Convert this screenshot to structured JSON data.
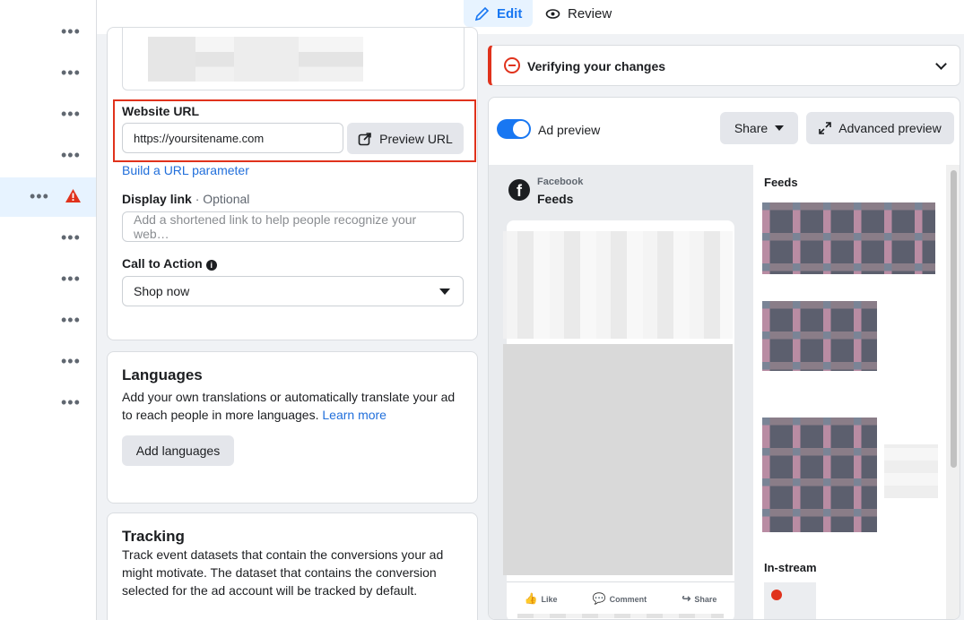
{
  "topbar": {
    "tabs": [
      {
        "label": "Edit",
        "icon": "pencil-icon",
        "active": true
      },
      {
        "label": "Review",
        "icon": "eye-icon",
        "active": false
      }
    ]
  },
  "rail": {
    "more_glyph": "•••",
    "warning_icon": "warning-triangle-icon",
    "warning_color": "#e0321c"
  },
  "destination": {
    "website_url_label": "Website URL",
    "website_url_value": "https://yoursitename.com",
    "preview_url_label": "Preview URL",
    "build_url_param": "Build a URL parameter",
    "display_link_label": "Display link",
    "display_link_optional": " · Optional",
    "display_link_placeholder": "Add a shortened link to help people recognize your web…",
    "cta_label": "Call to Action",
    "cta_info": "i",
    "cta_value": "Shop now"
  },
  "languages": {
    "title": "Languages",
    "description": "Add your own translations or automatically translate your ad to reach people in more languages.",
    "learn_more": "Learn more",
    "add_button": "Add languages"
  },
  "tracking": {
    "title": "Tracking",
    "description": "Track event datasets that contain the conversions your ad might motivate. The dataset that contains the conversion selected for the ad account will be tracked by default."
  },
  "verify": {
    "title": "Verifying your changes",
    "status_color": "#e0321c"
  },
  "preview": {
    "toggle_label": "Ad preview",
    "toggle_on": true,
    "share_label": "Share",
    "advanced_label": "Advanced preview",
    "platform_small": "Facebook",
    "platform_big": "Feeds",
    "fb_logo": "f",
    "actions": [
      {
        "icon": "👍",
        "label": "Like"
      },
      {
        "icon": "💬",
        "label": "Comment"
      },
      {
        "icon": "↪",
        "label": "Share"
      }
    ],
    "feeds_title": "Feeds",
    "instream_title": "In-stream"
  },
  "accent_color": "#1877f2"
}
